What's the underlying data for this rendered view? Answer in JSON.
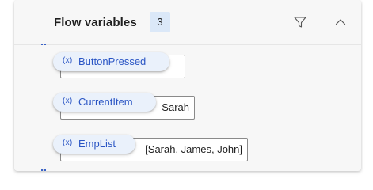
{
  "panel": {
    "title": "Flow variables",
    "count": "3",
    "filter_icon": "filter-icon",
    "collapse_icon": "chevron-up-icon"
  },
  "variables": [
    {
      "icon_text": "(x)",
      "name": "ButtonPressed",
      "value": ""
    },
    {
      "icon_text": "(x)",
      "name": "CurrentItem",
      "value": "Sarah"
    },
    {
      "icon_text": "(x)",
      "name": "EmpList",
      "value": "[Sarah, James, John]"
    }
  ],
  "colors": {
    "accent": "#3a63c8",
    "pill_bg": "#eaf1fb",
    "pill_text": "#2a55c4",
    "badge_bg": "#dbe8f8"
  }
}
